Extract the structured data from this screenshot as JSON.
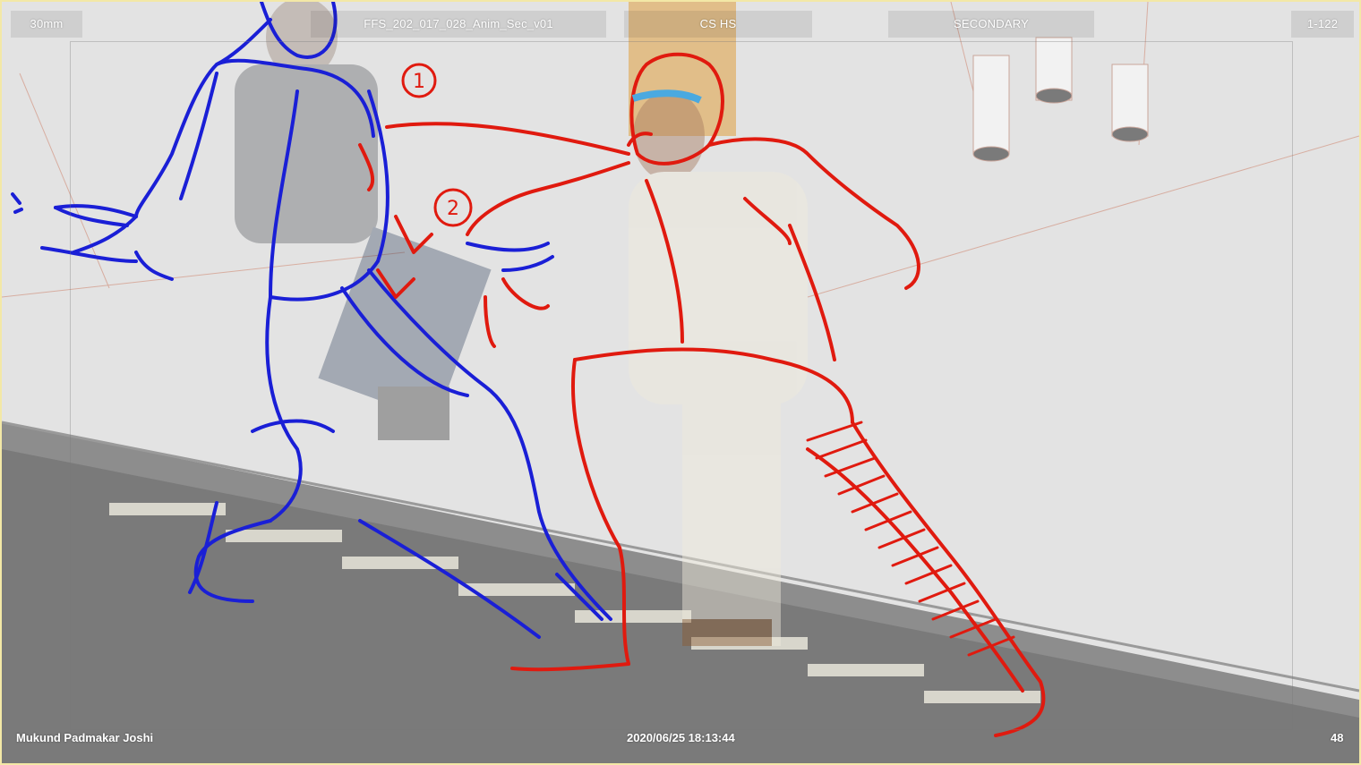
{
  "hud": {
    "lens": "30mm",
    "shot_name": "FFS_202_017_028_Anim_Sec_v01",
    "shot_type": "CS HS",
    "pass": "SECONDARY",
    "frame_range": "1-122",
    "artist": "Mukund Padmakar Joshi",
    "timestamp": "2020/06/25 18:13:44",
    "frame": "48"
  },
  "annotations": {
    "mark_1": "1",
    "mark_2": "2"
  },
  "colors": {
    "pose_blue": "#1a1fd6",
    "pose_red": "#e01a0f",
    "frame_border": "#f3e8a6"
  }
}
